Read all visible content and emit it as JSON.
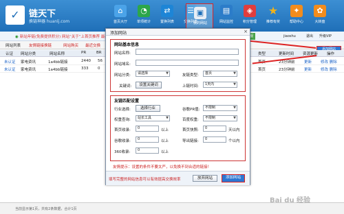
{
  "app": {
    "logo_name": "链天下",
    "logo_sub": "换链神器 huanlj.com"
  },
  "toolbar": [
    {
      "icon": "home-icon",
      "glyph": "⌂",
      "label": "首页大厅",
      "color": "#4ba3e8"
    },
    {
      "icon": "chart-icon",
      "glyph": "◔",
      "label": "单项统计",
      "color": "#2ca64a"
    },
    {
      "icon": "exchange-icon",
      "glyph": "⇄",
      "label": "置换列表",
      "color": "#1d85d6"
    },
    {
      "icon": "list-icon",
      "glyph": "☰",
      "label": "交换列表",
      "color": "#1d85d6"
    },
    {
      "icon": "site-icon",
      "glyph": "▣",
      "label": "我的网站",
      "color": "#e9eef5"
    },
    {
      "icon": "monitor-icon",
      "glyph": "▤",
      "label": "网站监控",
      "color": "#2b7cc9"
    },
    {
      "icon": "points-icon",
      "glyph": "◈",
      "label": "积分管理",
      "color": "#e03d3d"
    },
    {
      "icon": "star-icon",
      "glyph": "★",
      "label": "推荐有奖",
      "color": "#f0b21b"
    },
    {
      "icon": "qa-icon",
      "glyph": "✦",
      "label": "帮助中心",
      "color": "#f28c1c"
    },
    {
      "icon": "gift-icon",
      "glyph": "✿",
      "label": "大转盘",
      "color": "#f28c1c"
    }
  ],
  "subbar": {
    "notice": "新站年链(免费提供积分)   网站“关于”上首页推荐   最新公告",
    "service": "在线客服",
    "user": "jiaoshu",
    "logout": "退出",
    "upgrade": "升级VIP"
  },
  "tabs": {
    "items": [
      "网站列表",
      "友情链接换链",
      "网站购买",
      "最近交换"
    ],
    "add_site": "添加网站"
  },
  "table": {
    "headers": [
      "认证",
      "网站分类",
      "网站名称",
      "PR",
      "BR",
      "类型",
      "更新时间",
      "资源更新",
      "操作"
    ],
    "rows": [
      {
        "verify": "未认证",
        "category": "家电资讯",
        "name": "1a4bb链接",
        "pr": "2440",
        "br": "56",
        "type": "首页",
        "time": "23分钟前",
        "update": "更新",
        "ops": "修改 删除"
      },
      {
        "verify": "未认证",
        "category": "家电资讯",
        "name": "1a4bb链接",
        "pr": "333",
        "br": "0",
        "type": "首页",
        "time": "23分钟前",
        "update": "更新",
        "ops": "修改 删除"
      }
    ]
  },
  "footer": {
    "status": "当前显示第1页，共有2条数据，合计1页"
  },
  "dialog": {
    "title": "添加网站",
    "close": "×",
    "basic_title": "网站基本信息",
    "site_name_label": "网站名称:",
    "site_name_value": "",
    "url_label": "网站域名:",
    "url_value": "",
    "category_label": "网站分类:",
    "category_value": "请选择",
    "keyword_label": "关键词:",
    "keyword_button": "设置关键词",
    "link_type_label": "友链类型:",
    "link_type_value": "首页",
    "online_time_label": "上链时间:",
    "online_time_value": "1天内",
    "condition_title": "友链匹配设置",
    "industry_label": "行业选择:",
    "industry_button": "选择行业",
    "google_pr_label": "谷歌PR值:",
    "google_pr_value": "不限制",
    "weight_label": "权重查询:",
    "weight_value": "站长工具",
    "baidu_weight_label": "百度权重:",
    "baidu_weight_value": "不限制",
    "baidu_index_label": "首页收录:",
    "baidu_index_value": "0",
    "baidu_index_unit": "以上",
    "snapshot_label": "首页快照:",
    "snapshot_value": "0",
    "snapshot_unit": "天以内",
    "google_index_label": "谷歌收录:",
    "google_index_value": "0",
    "google_index_unit": "以上",
    "outlinks_label": "导出链接:",
    "outlinks_value": "0",
    "outlinks_unit": "个以内",
    "s360_label": "360收录:",
    "s360_value": "0",
    "s360_unit": "以上",
    "tip": "友情提示：设置的条件不要太严，以免换不到合适的链接！",
    "footer_note": "填写完整的网站信息可以有效提高交换效率",
    "cancel_button": "放弃网站",
    "submit_button": "添加网站"
  },
  "watermark": "Bai du 经验"
}
